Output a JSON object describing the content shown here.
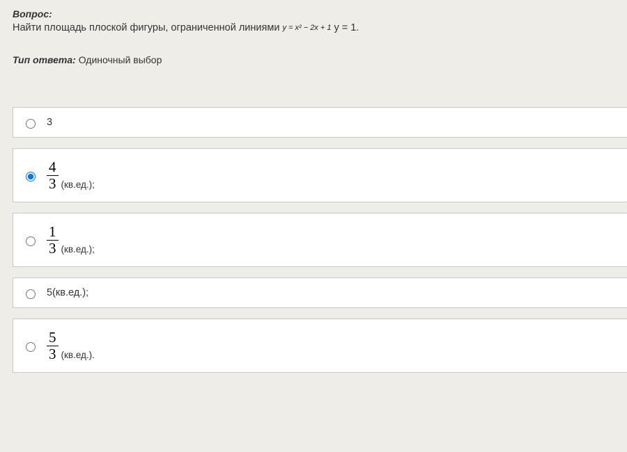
{
  "question": {
    "label": "Вопрос:",
    "text_before": "Найти площадь плоской фигуры, ограниченной линиями",
    "formula": "y = x² − 2x + 1",
    "text_after": "  y = 1."
  },
  "answer_type": {
    "label": "Тип ответа:",
    "value": "Одиночный выбор"
  },
  "options": [
    {
      "kind": "plain",
      "text": "3",
      "unit": "",
      "selected": false
    },
    {
      "kind": "fraction",
      "num": "4",
      "den": "3",
      "unit": "(кв.ед.);",
      "selected": true
    },
    {
      "kind": "fraction",
      "num": "1",
      "den": "3",
      "unit": "(кв.ед.);",
      "selected": false
    },
    {
      "kind": "plain",
      "text": "5",
      "unit": " (кв.ед.);",
      "selected": false
    },
    {
      "kind": "fraction",
      "num": "5",
      "den": "3",
      "unit": "(кв.ед.).",
      "selected": false
    }
  ]
}
